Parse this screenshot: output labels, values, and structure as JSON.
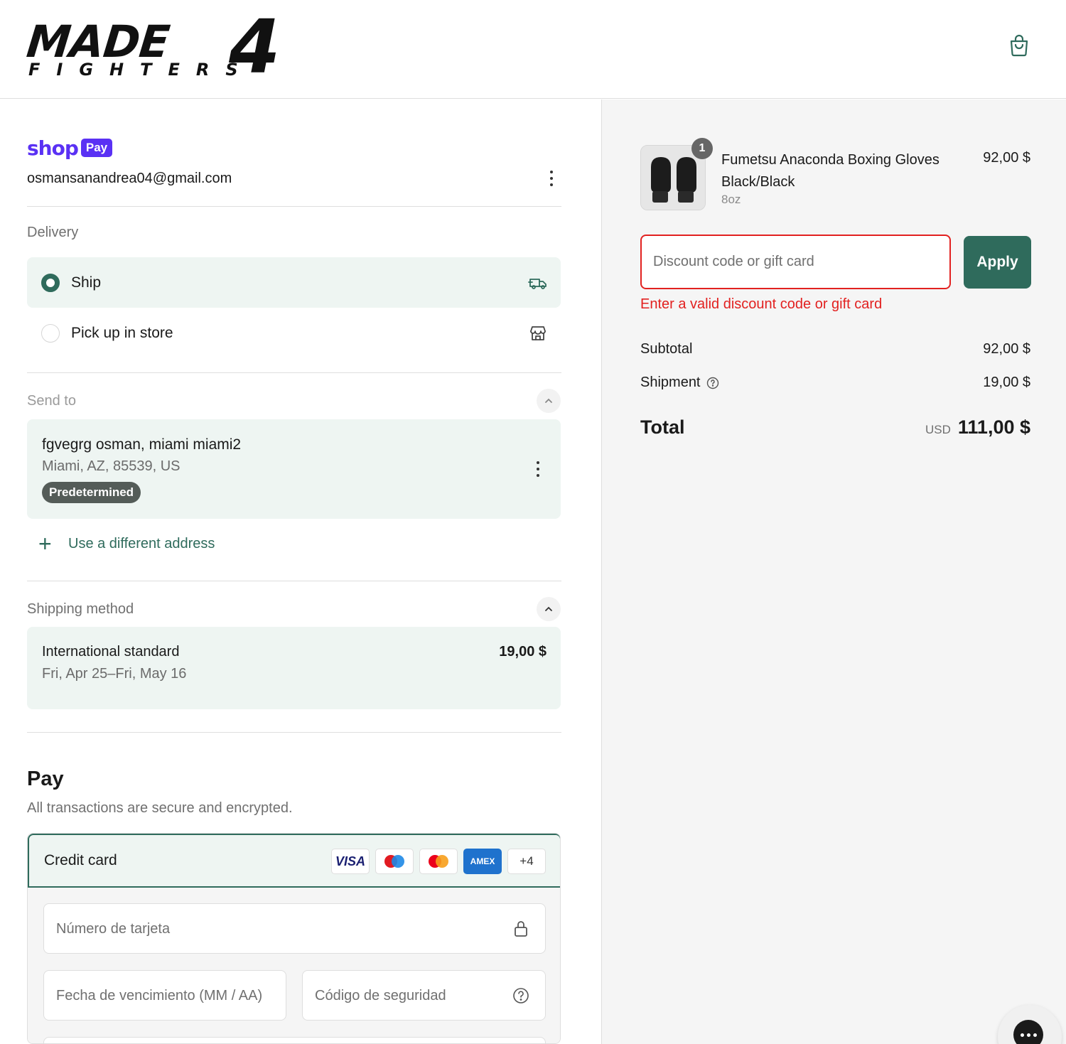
{
  "header": {
    "logo_top": "MADE",
    "logo_digit": "4",
    "logo_bottom": "FIGHTERS",
    "cart_icon": "shopping-bag-icon"
  },
  "account": {
    "shop_word": "shop",
    "shop_pay": "Pay",
    "email": "osmansanandrea04@gmail.com"
  },
  "delivery": {
    "label": "Delivery",
    "options": [
      {
        "label": "Ship",
        "selected": true,
        "icon": "truck-icon"
      },
      {
        "label": "Pick up in store",
        "selected": false,
        "icon": "store-icon"
      }
    ]
  },
  "send_to": {
    "label": "Send to",
    "address_line1": "fgvegrg osman, miami miami2",
    "address_line2": "Miami, AZ, 85539, US",
    "badge": "Predetermined",
    "use_different": "Use a different address"
  },
  "shipping_method": {
    "label": "Shipping method",
    "name": "International standard",
    "dates": "Fri, Apr 25–Fri, May 16",
    "price": "19,00 $"
  },
  "pay": {
    "title": "Pay",
    "subtitle": "All transactions are secure and encrypted.",
    "credit_card_label": "Credit card",
    "card_brands": [
      "VISA",
      "maestro",
      "mastercard",
      "AMEX"
    ],
    "more_cards": "+4",
    "card_number_placeholder": "Número de tarjeta",
    "expiry_placeholder": "Fecha de vencimiento (MM / AA)",
    "cvc_placeholder": "Código de seguridad"
  },
  "summary": {
    "item": {
      "quantity": "1",
      "name": "Fumetsu Anaconda Boxing Gloves Black/Black",
      "variant": "8oz",
      "price": "92,00 $"
    },
    "discount_placeholder": "Discount code or gift card",
    "apply_label": "Apply",
    "discount_error": "Enter a valid discount code or gift card",
    "subtotal_label": "Subtotal",
    "subtotal_value": "92,00 $",
    "shipment_label": "Shipment",
    "shipment_value": "19,00 $",
    "total_label": "Total",
    "total_currency": "USD",
    "total_value": "111,00 $"
  },
  "colors": {
    "accent": "#2f6b5c",
    "shop_purple": "#5a31f4",
    "error": "#e22120",
    "selected_bg": "#eef5f2"
  }
}
